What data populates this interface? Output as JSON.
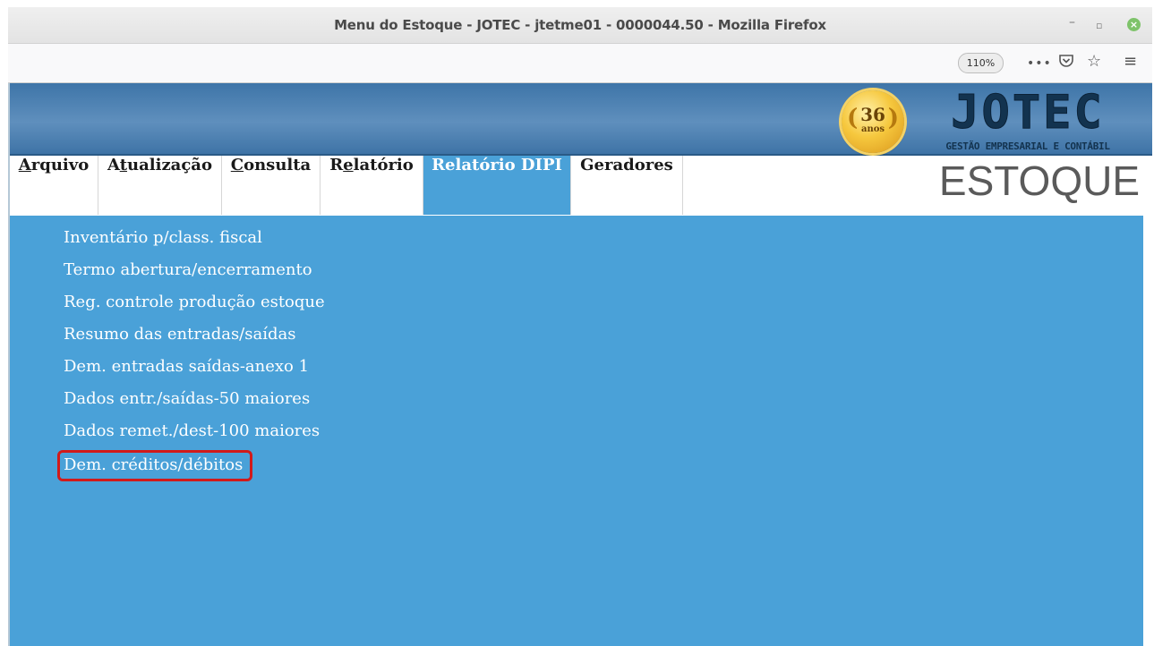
{
  "window": {
    "title": "Menu do Estoque - JOTEC - jtetme01 - 0000044.50 - Mozilla Firefox",
    "minimize_icon": "minimize-icon",
    "maximize_icon": "maximize-icon",
    "close_icon": "close-icon"
  },
  "toolbar": {
    "zoom_level": "110%",
    "more_icon": "more-actions-icon",
    "pocket_icon": "pocket-icon",
    "bookmark_icon": "star-icon",
    "menu_icon": "hamburger-menu-icon"
  },
  "banner": {
    "seal_number": "36",
    "seal_word": "anos",
    "logo": "JOTEC",
    "logo_subtitle": "GESTÃO EMPRESARIAL E CONTÁBIL"
  },
  "menu": {
    "items": [
      {
        "pre": "",
        "key": "A",
        "post": "rquivo"
      },
      {
        "pre": "A",
        "key": "t",
        "post": "ualização"
      },
      {
        "pre": "",
        "key": "C",
        "post": "onsulta"
      },
      {
        "pre": "R",
        "key": "e",
        "post": "latório"
      },
      {
        "label": "Relatório DIPI",
        "active": true
      },
      {
        "label": "Geradores"
      }
    ],
    "module_title": "ESTOQUE"
  },
  "submenu": {
    "items": [
      "Inventário p/class. fiscal",
      "Termo abertura/encerramento",
      "Reg. controle produção estoque",
      "Resumo das entradas/saídas",
      "Dem. entradas saídas-anexo 1",
      "Dados entr./saídas-50 maiores",
      "Dados remet./dest-100 maiores",
      "Dem. créditos/débitos"
    ],
    "highlighted_index": 7
  },
  "colors": {
    "content_bg": "#4aa1d8",
    "highlight_border": "#d11a1a",
    "banner_bg": "#4f83b4"
  }
}
